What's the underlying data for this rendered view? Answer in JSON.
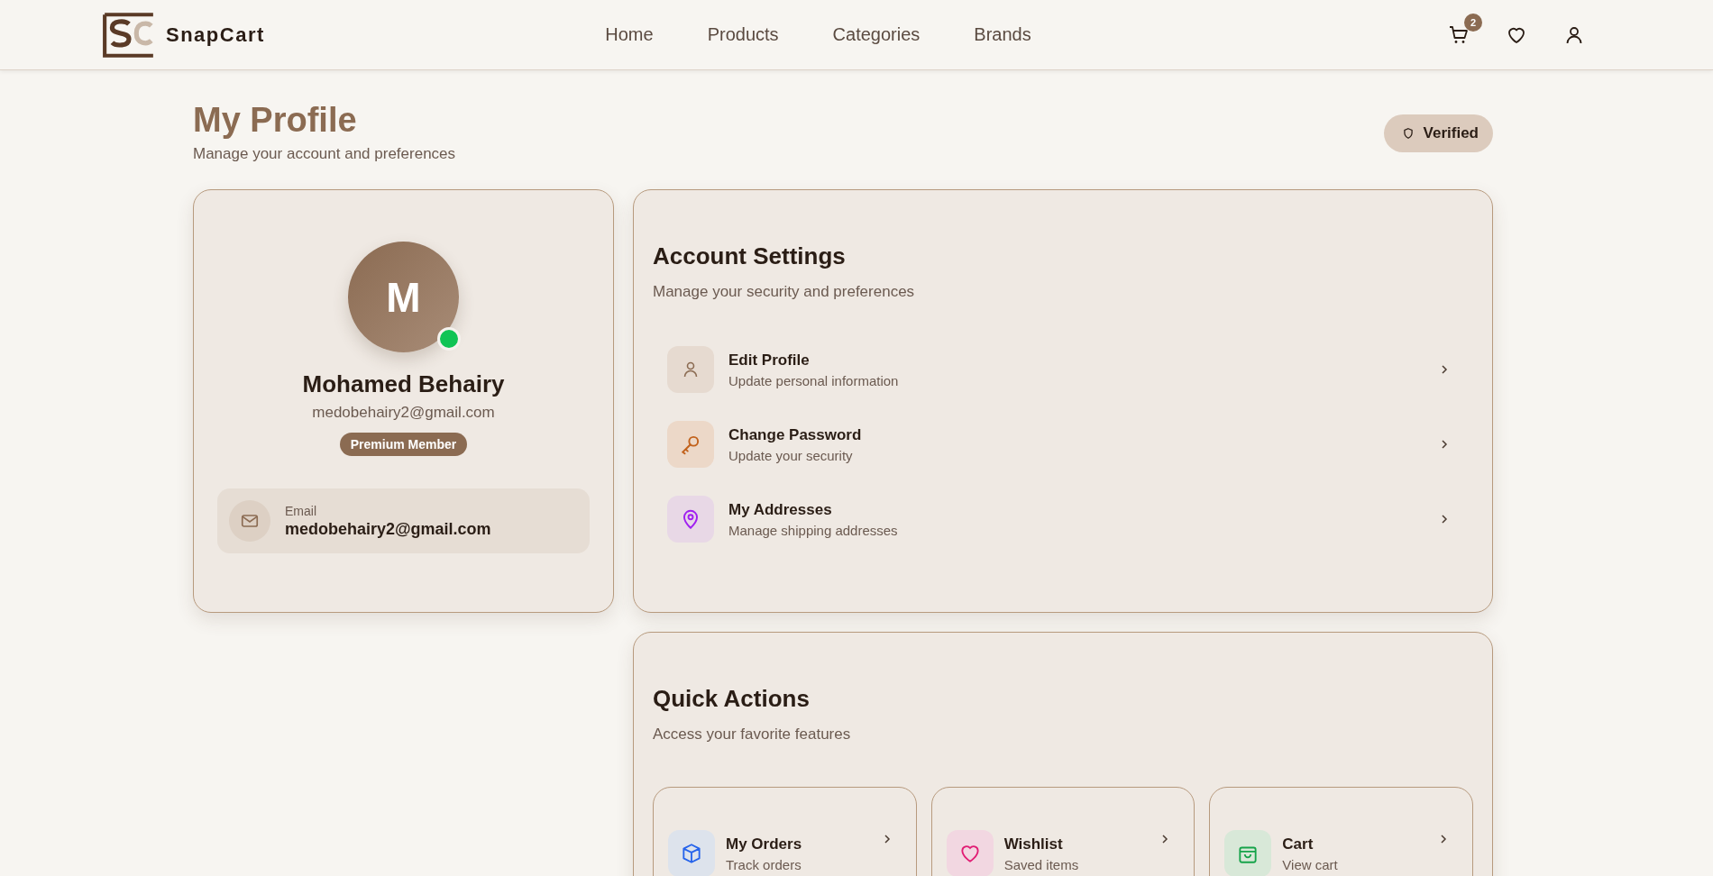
{
  "header": {
    "brand": "SnapCart",
    "nav": [
      {
        "label": "Home"
      },
      {
        "label": "Products"
      },
      {
        "label": "Categories"
      },
      {
        "label": "Brands"
      }
    ],
    "cart_count": "2"
  },
  "page": {
    "title": "My Profile",
    "subtitle": "Manage your account and preferences",
    "status": "Verified"
  },
  "profile": {
    "initial": "M",
    "online": true,
    "name": "Mohamed Behairy",
    "email": "medobehairy2@gmail.com",
    "badge": "Premium Member",
    "fields": [
      {
        "label": "Email",
        "value": "medobehairy2@gmail.com"
      }
    ]
  },
  "account_settings": {
    "title": "Account Settings",
    "subtitle": "Manage your security and preferences",
    "items": [
      {
        "kind": "user",
        "title": "Edit Profile",
        "subtitle": "Update personal information"
      },
      {
        "kind": "key",
        "title": "Change Password",
        "subtitle": "Update your security"
      },
      {
        "kind": "pin",
        "title": "My Addresses",
        "subtitle": "Manage shipping addresses"
      }
    ]
  },
  "quick_actions": {
    "title": "Quick Actions",
    "subtitle": "Access your favorite features",
    "items": [
      {
        "kind": "box",
        "title": "My Orders",
        "subtitle": "Track orders"
      },
      {
        "kind": "heart",
        "title": "Wishlist",
        "subtitle": "Saved items"
      },
      {
        "kind": "bag",
        "title": "Cart",
        "subtitle": "View cart"
      }
    ]
  }
}
